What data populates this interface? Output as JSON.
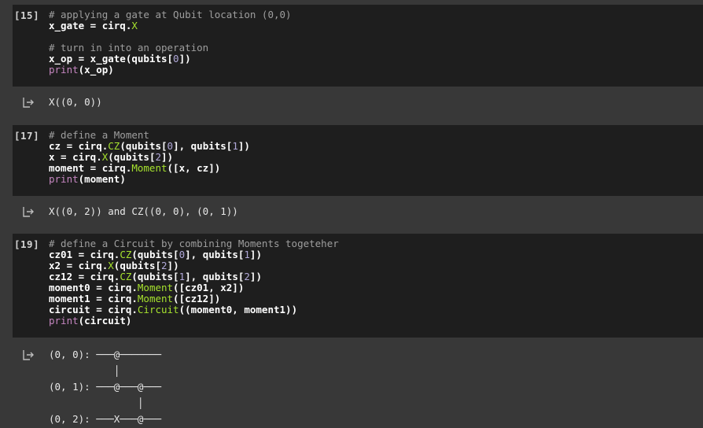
{
  "cells": [
    {
      "prompt": "[15]",
      "code": [
        [
          [
            "cm",
            "# applying a gate at Qubit location (0,0)"
          ]
        ],
        [
          [
            "",
            "x_gate = cirq."
          ],
          [
            "cls",
            "X"
          ]
        ],
        [
          [
            "",
            ""
          ]
        ],
        [
          [
            "cm",
            "# turn in into an operation"
          ]
        ],
        [
          [
            "",
            "x_op = x_gate(qubits["
          ],
          [
            "num",
            "0"
          ],
          [
            "",
            "])"
          ]
        ],
        [
          [
            "kw",
            "print"
          ],
          [
            "",
            "(x_op)"
          ]
        ]
      ],
      "output": "X((0, 0))"
    },
    {
      "prompt": "[17]",
      "code": [
        [
          [
            "cm",
            "# define a Moment"
          ]
        ],
        [
          [
            "",
            "cz = cirq."
          ],
          [
            "cls",
            "CZ"
          ],
          [
            "",
            "(qubits["
          ],
          [
            "num",
            "0"
          ],
          [
            "",
            "], qubits["
          ],
          [
            "num",
            "1"
          ],
          [
            "",
            "])"
          ]
        ],
        [
          [
            "",
            "x = cirq."
          ],
          [
            "cls",
            "X"
          ],
          [
            "",
            "(qubits["
          ],
          [
            "num",
            "2"
          ],
          [
            "",
            "])"
          ]
        ],
        [
          [
            "",
            "moment = cirq."
          ],
          [
            "cls",
            "Moment"
          ],
          [
            "",
            "([x, cz])"
          ]
        ],
        [
          [
            "kw",
            "print"
          ],
          [
            "",
            "(moment)"
          ]
        ]
      ],
      "output": "X((0, 2)) and CZ((0, 0), (0, 1))"
    },
    {
      "prompt": "[19]",
      "code": [
        [
          [
            "cm",
            "# define a Circuit by combining Moments togeteher"
          ]
        ],
        [
          [
            "",
            "cz01 = cirq."
          ],
          [
            "cls",
            "CZ"
          ],
          [
            "",
            "(qubits["
          ],
          [
            "num",
            "0"
          ],
          [
            "",
            "], qubits["
          ],
          [
            "num",
            "1"
          ],
          [
            "",
            "])"
          ]
        ],
        [
          [
            "",
            "x2 = cirq."
          ],
          [
            "cls",
            "X"
          ],
          [
            "",
            "(qubits["
          ],
          [
            "num",
            "2"
          ],
          [
            "",
            "])"
          ]
        ],
        [
          [
            "",
            "cz12 = cirq."
          ],
          [
            "cls",
            "CZ"
          ],
          [
            "",
            "(qubits["
          ],
          [
            "num",
            "1"
          ],
          [
            "",
            "], qubits["
          ],
          [
            "num",
            "2"
          ],
          [
            "",
            "])"
          ]
        ],
        [
          [
            "",
            "moment0 = cirq."
          ],
          [
            "cls",
            "Moment"
          ],
          [
            "",
            "([cz01, x2])"
          ]
        ],
        [
          [
            "",
            "moment1 = cirq."
          ],
          [
            "cls",
            "Moment"
          ],
          [
            "",
            "([cz12])"
          ]
        ],
        [
          [
            "",
            "circuit = cirq."
          ],
          [
            "cls",
            "Circuit"
          ],
          [
            "",
            "((moment0, moment1))"
          ]
        ],
        [
          [
            "kw",
            "print"
          ],
          [
            "",
            "(circuit)"
          ]
        ]
      ],
      "output_lines": [
        "(0, 0): ───@───────",
        "           │",
        "(0, 1): ───@───@───",
        "               │",
        "(0, 2): ───X───@───"
      ]
    }
  ],
  "icons": {
    "output": "output-arrow-icon"
  },
  "colors": {
    "background": "#383838",
    "code_bg": "#1e1e1e",
    "comment": "#9e9e9e",
    "keyword": "#c586c0",
    "class": "#a6e22e",
    "number": "#b0a8d8"
  }
}
